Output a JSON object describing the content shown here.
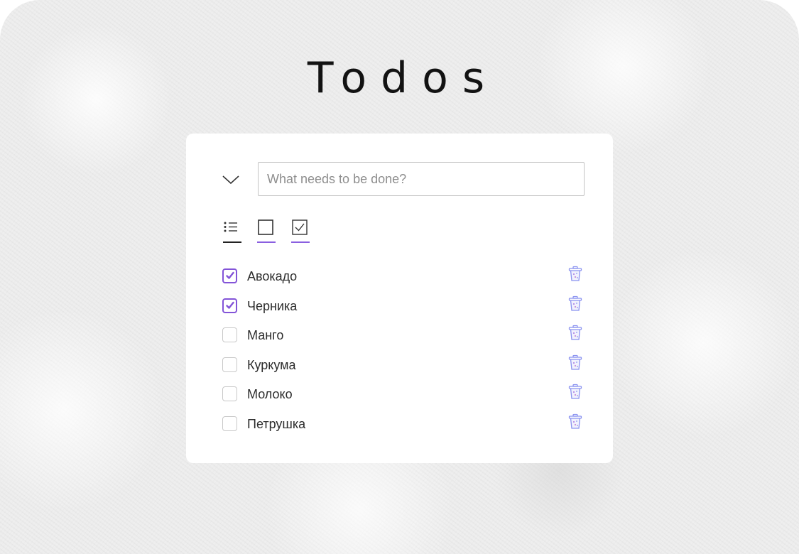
{
  "app": {
    "title": "Todos"
  },
  "new_todo": {
    "placeholder": "What needs to be done?",
    "value": ""
  },
  "filters": [
    {
      "name": "all",
      "icon": "list-icon",
      "active": true
    },
    {
      "name": "active",
      "icon": "empty-checkbox-icon",
      "active": false
    },
    {
      "name": "completed",
      "icon": "checked-checkbox-icon",
      "active": false
    }
  ],
  "todos": [
    {
      "label": "Авокадо",
      "completed": true
    },
    {
      "label": "Черника",
      "completed": true
    },
    {
      "label": "Манго",
      "completed": false
    },
    {
      "label": "Куркума",
      "completed": false
    },
    {
      "label": "Молоко",
      "completed": false
    },
    {
      "label": "Петрушка",
      "completed": false
    }
  ],
  "colors": {
    "accent": "#8354d8",
    "delete_icon": "#8b93f0",
    "active_filter_underline": "#222222",
    "inactive_filter_underline": "#8a5fe0"
  }
}
